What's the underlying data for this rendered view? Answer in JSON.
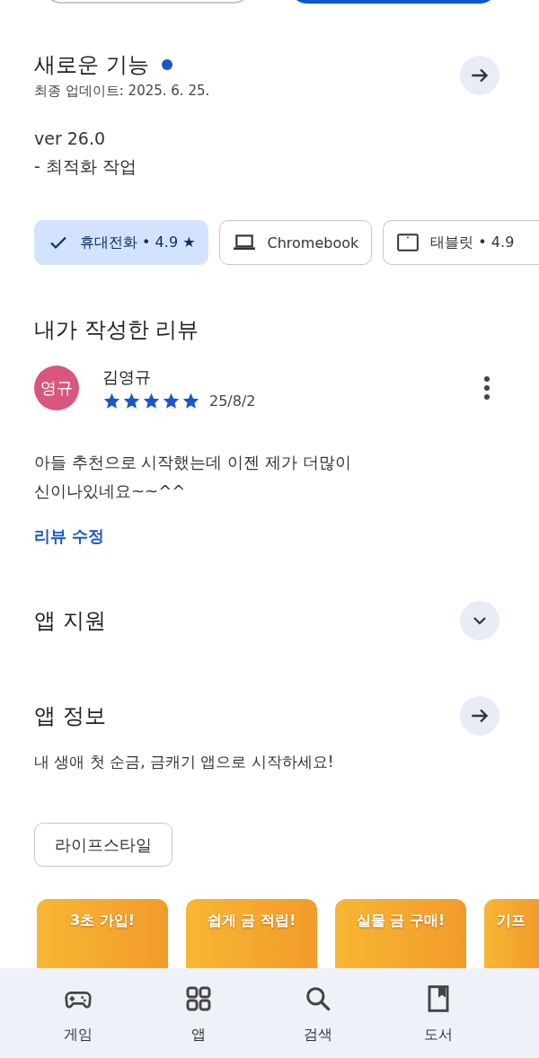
{
  "whats_new": {
    "title": "새로운 기능",
    "new_dot": true,
    "updated": "최종 업데이트: 2025. 6. 25.",
    "notes": [
      "ver 26.0",
      "- 최적화 작업"
    ]
  },
  "device_chips": [
    {
      "kind": "phone",
      "label": "휴대전화 • 4.9 ★",
      "selected": true
    },
    {
      "kind": "laptop",
      "label": "Chromebook",
      "selected": false
    },
    {
      "kind": "tablet",
      "label": "태블릿 • 4.9",
      "selected": false
    }
  ],
  "my_review": {
    "title": "내가 작성한 리뷰",
    "avatar_text": "영규",
    "author": "김영규",
    "stars": 5,
    "date": "25/8/2",
    "text": "아들 추천으로 시작했는데 이젠 제가 더많이\n신이나있네요~~^^",
    "edit_link": "리뷰 수정"
  },
  "app_support": {
    "title": "앱 지원",
    "expanded": false
  },
  "app_info": {
    "title": "앱 정보",
    "description": "내 생애 첫 순금, 금캐기 앱으로 시작하세요!",
    "category": "라이프스타일"
  },
  "screenshots": [
    {
      "caption": "3초 가입!"
    },
    {
      "caption": "쉽게 금 적립!"
    },
    {
      "caption": "실물 금 구매!"
    },
    {
      "caption": "기프"
    }
  ],
  "bottom_nav": [
    {
      "label": "게임"
    },
    {
      "label": "앱"
    },
    {
      "label": "검색"
    },
    {
      "label": "도서"
    }
  ]
}
